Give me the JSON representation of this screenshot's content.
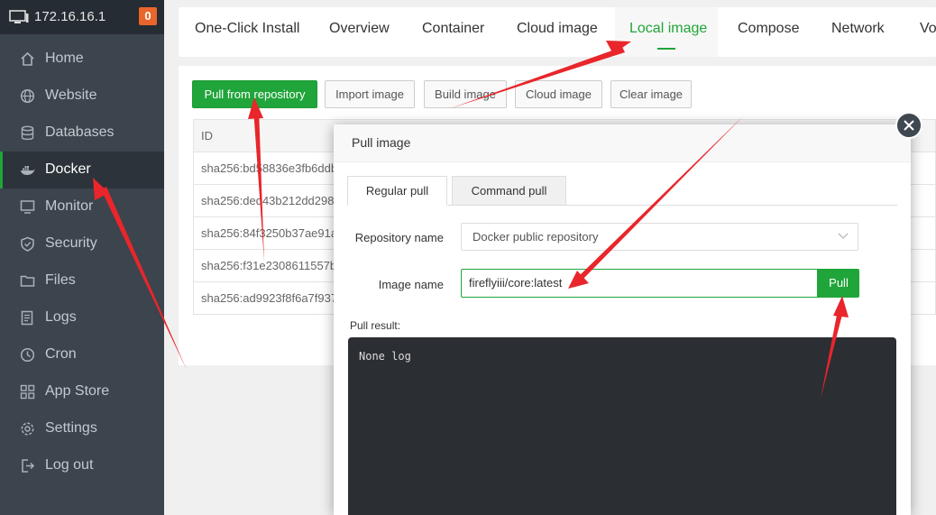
{
  "sidebar": {
    "host": "172.16.16.1",
    "badge": "0",
    "items": [
      {
        "label": "Home",
        "icon": "home-icon"
      },
      {
        "label": "Website",
        "icon": "globe-icon"
      },
      {
        "label": "Databases",
        "icon": "database-icon"
      },
      {
        "label": "Docker",
        "icon": "docker-icon"
      },
      {
        "label": "Monitor",
        "icon": "monitor-icon"
      },
      {
        "label": "Security",
        "icon": "shield-icon"
      },
      {
        "label": "Files",
        "icon": "folder-icon"
      },
      {
        "label": "Logs",
        "icon": "log-icon"
      },
      {
        "label": "Cron",
        "icon": "clock-icon"
      },
      {
        "label": "App Store",
        "icon": "grid-icon"
      },
      {
        "label": "Settings",
        "icon": "gear-icon"
      },
      {
        "label": "Log out",
        "icon": "logout-icon"
      }
    ],
    "active": "Docker"
  },
  "tabs": [
    "One-Click Install",
    "Overview",
    "Container",
    "Cloud image",
    "Local image",
    "Compose",
    "Network",
    "Vo"
  ],
  "active_tab": "Local image",
  "toolbar": {
    "pull": "Pull from repository",
    "import": "Import image",
    "build": "Build image",
    "cloud": "Cloud image",
    "clear": "Clear image"
  },
  "table": {
    "header": "ID",
    "rows": [
      "sha256:bd58836e3fb6ddb",
      "sha256:ded43b212dd298",
      "sha256:84f3250b37ae91a",
      "sha256:f31e2308611557b",
      "sha256:ad9923f8f6a7f937"
    ]
  },
  "modal": {
    "title": "Pull image",
    "tabs": [
      "Regular pull",
      "Command pull"
    ],
    "repo_label": "Repository name",
    "repo_value": "Docker public repository",
    "image_label": "Image name",
    "image_value": "fireflyiii/core:latest",
    "pull_button": "Pull",
    "result_label": "Pull result:",
    "log": "None log"
  },
  "colors": {
    "accent": "#20a53a",
    "sidebar": "#3c444d",
    "badge": "#e8652b",
    "annotation": "#e8262b"
  }
}
